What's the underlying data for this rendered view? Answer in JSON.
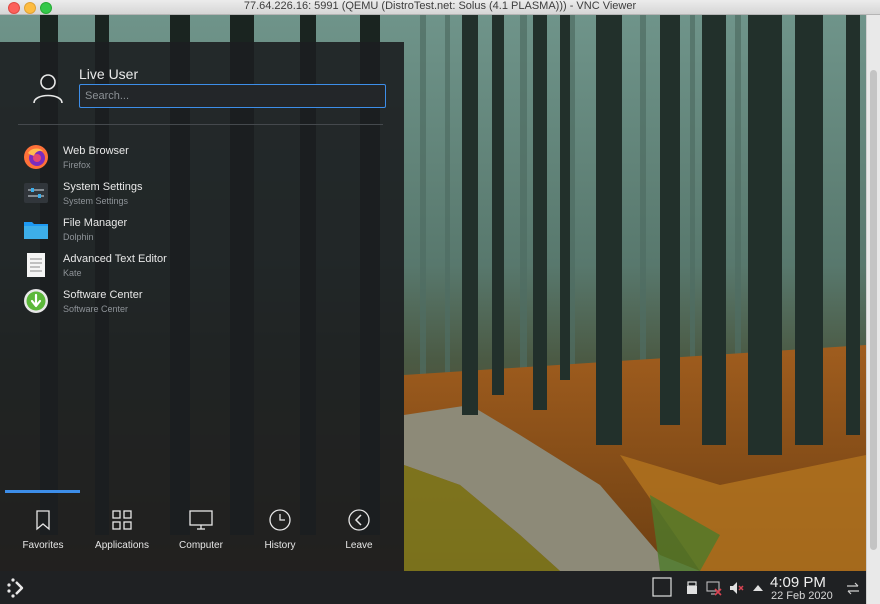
{
  "window": {
    "title": "77.64.226.16: 5991 (QEMU (DistroTest.net: Solus (4.1 PLASMA))) - VNC Viewer"
  },
  "launcher": {
    "user_name": "Live User",
    "search_placeholder": "Search...",
    "favorites": [
      {
        "name": "Web Browser",
        "subtitle": "Firefox",
        "icon": "firefox-icon"
      },
      {
        "name": "System Settings",
        "subtitle": "System Settings",
        "icon": "settings-icon"
      },
      {
        "name": "File Manager",
        "subtitle": "Dolphin",
        "icon": "folder-icon"
      },
      {
        "name": "Advanced Text Editor",
        "subtitle": "Kate",
        "icon": "text-editor-icon"
      },
      {
        "name": "Software Center",
        "subtitle": "Software Center",
        "icon": "software-center-icon"
      }
    ],
    "tabs": [
      {
        "label": "Favorites",
        "icon": "bookmark-icon",
        "active": true
      },
      {
        "label": "Applications",
        "icon": "grid-icon",
        "active": false
      },
      {
        "label": "Computer",
        "icon": "monitor-icon",
        "active": false
      },
      {
        "label": "History",
        "icon": "clock-icon",
        "active": false
      },
      {
        "label": "Leave",
        "icon": "back-arrow-icon",
        "active": false
      }
    ],
    "accent_color": "#3d8ee9"
  },
  "taskbar": {
    "time": "4:09 PM",
    "date": "22 Feb 2020",
    "tray_icons": [
      "show-desktop-icon",
      "usb-icon",
      "network-disconnected-icon",
      "volume-muted-icon",
      "tray-expand-icon",
      "panel-settings-icon"
    ]
  }
}
